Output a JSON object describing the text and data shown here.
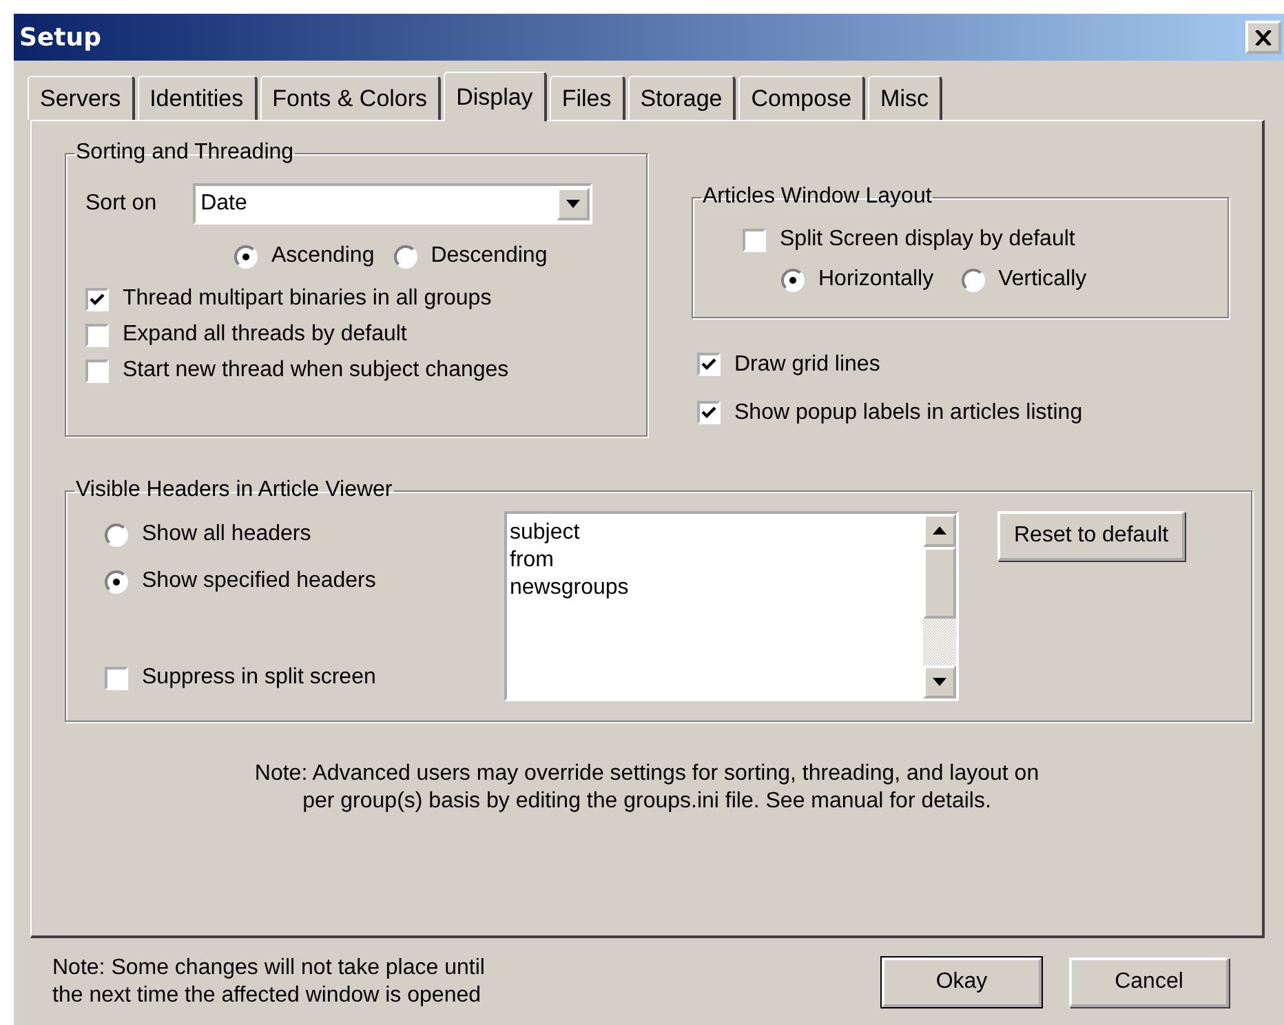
{
  "window": {
    "title": "Setup"
  },
  "tabs": [
    {
      "label": "Servers",
      "selected": false
    },
    {
      "label": "Identities",
      "selected": false
    },
    {
      "label": "Fonts & Colors",
      "selected": false
    },
    {
      "label": "Display",
      "selected": true
    },
    {
      "label": "Files",
      "selected": false
    },
    {
      "label": "Storage",
      "selected": false
    },
    {
      "label": "Compose",
      "selected": false
    },
    {
      "label": "Misc",
      "selected": false
    }
  ],
  "sorting": {
    "title": "Sorting and Threading",
    "sort_label": "Sort on",
    "sort_value": "Date",
    "order": [
      {
        "label": "Ascending",
        "selected": true
      },
      {
        "label": "Descending",
        "selected": false
      }
    ],
    "options": [
      {
        "label": "Thread multipart binaries in all groups",
        "checked": true
      },
      {
        "label": "Expand all threads by default",
        "checked": false
      },
      {
        "label": "Start new thread when subject changes",
        "checked": false
      }
    ]
  },
  "layout": {
    "title": "Articles Window Layout",
    "split": {
      "label": "Split Screen display by default",
      "checked": false
    },
    "orientation": [
      {
        "label": "Horizontally",
        "selected": true
      },
      {
        "label": "Vertically",
        "selected": false
      }
    ]
  },
  "list_options": [
    {
      "label": "Draw grid lines",
      "checked": true
    },
    {
      "label": "Show popup labels in articles listing",
      "checked": true
    }
  ],
  "headers": {
    "title": "Visible Headers in Article Viewer",
    "modes": [
      {
        "label": "Show all headers",
        "selected": false
      },
      {
        "label": "Show specified headers",
        "selected": true
      }
    ],
    "suppress": {
      "label": "Suppress in split screen",
      "checked": false
    },
    "items": [
      "subject",
      "from",
      "newsgroups"
    ],
    "reset_button": "Reset to default"
  },
  "note": [
    "Note: Advanced users may override settings for sorting, threading, and layout on",
    "per group(s) basis by editing the groups.ini file.  See manual for details."
  ],
  "footer_note": [
    "Note: Some changes will not take place until",
    "the next time the affected window is opened"
  ],
  "buttons": [
    "Okay",
    "Cancel"
  ]
}
